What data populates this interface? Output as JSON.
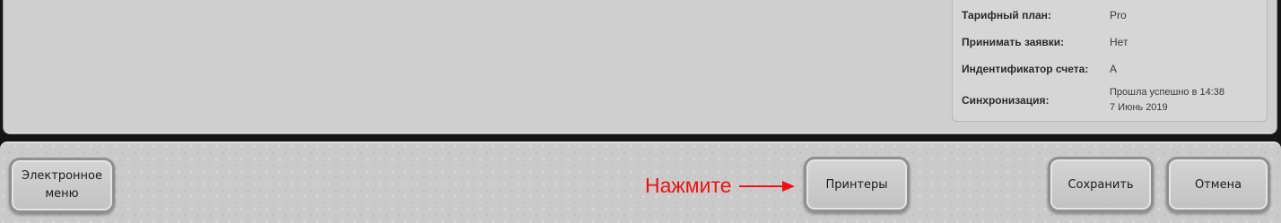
{
  "account_info": {
    "rows": [
      {
        "label": "Тарифный план:",
        "value": "Pro"
      },
      {
        "label": "Принимать заявки:",
        "value": "Нет"
      },
      {
        "label": "Индентификатор счета:",
        "value": "A"
      },
      {
        "label": "Синхронизация:",
        "value_line1": "Прошла успешно в 14:38",
        "value_line2": "7 Июнь 2019"
      }
    ]
  },
  "toolbar": {
    "menu_button_line1": "Электронное",
    "menu_button_line2": "меню",
    "printers_button": "Принтеры",
    "save_button": "Сохранить",
    "cancel_button": "Отмена"
  },
  "annotation": {
    "text": "Нажмите",
    "color": "#ee1111"
  },
  "icons": {
    "arrow": "right-arrow-icon"
  }
}
